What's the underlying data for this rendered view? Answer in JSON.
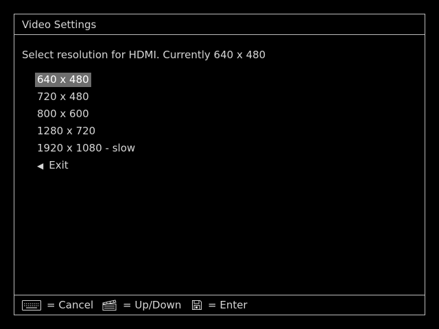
{
  "window": {
    "title": "Video Settings"
  },
  "prompt": "Select resolution for HDMI. Currently 640 x 480",
  "menu": {
    "selected_index": 0,
    "items": [
      {
        "label": "640 x 480"
      },
      {
        "label": "720 x 480"
      },
      {
        "label": "800 x 600"
      },
      {
        "label": "1280 x 720"
      },
      {
        "label": "1920 x 1080 - slow"
      }
    ],
    "exit": {
      "icon": "left-triangle-icon",
      "label": "Exit"
    }
  },
  "footer": {
    "hints": [
      {
        "icon": "keyboard-icon",
        "label": "= Cancel"
      },
      {
        "icon": "clapperboard-icon",
        "label": "= Up/Down"
      },
      {
        "icon": "floppy-disk-icon",
        "label": "= Enter"
      }
    ]
  },
  "colors": {
    "background": "#000000",
    "text": "#d6d6d6",
    "border": "#bdbdbd",
    "selection": "#6e6e6e"
  }
}
